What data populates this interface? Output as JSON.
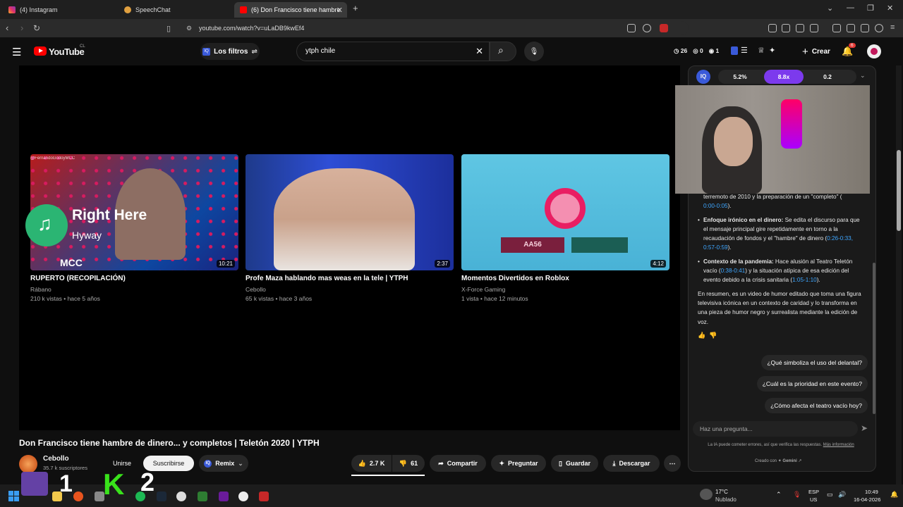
{
  "browser": {
    "tabs": [
      {
        "label": "(4) Instagram",
        "icon": "instagram-icon"
      },
      {
        "label": "SpeechChat",
        "icon": "speechchat-icon"
      },
      {
        "label": "(6) Don Francisco tiene hambre",
        "icon": "youtube-icon",
        "active": true
      }
    ],
    "url": "youtube.com/watch?v=uLaDB9kwEf4",
    "extension_badge": "2"
  },
  "youtube": {
    "logo": "YouTube",
    "logo_region": "CL",
    "filter_label": "Los filtros",
    "search_value": "ytph chile",
    "stats": {
      "a": "26",
      "b": "0",
      "c": "1"
    },
    "create_label": "Crear",
    "notif_count": "6"
  },
  "endscreen": {
    "cards": [
      {
        "title": "RUPERTO (RECOPILACIÓN)",
        "channel": "Rábano",
        "meta": "210 k vistas • hace 5 años",
        "duration": "10:21",
        "watermark": "@FernandoGodoyMCC",
        "thumb_label": "MCC"
      },
      {
        "title": "Profe Maza hablando mas weas en la tele | YTPH",
        "channel": "Cebollo",
        "meta": "65 k vistas • hace 3 años",
        "duration": "2:37"
      },
      {
        "title": "Momentos Divertidos en Roblox",
        "channel": "X-Force Gaming",
        "meta": "1 vista • hace 12 minutos",
        "duration": "4:12",
        "thumb_label": "AA56"
      }
    ]
  },
  "now_playing": {
    "title": "Right Here",
    "artist": "Hyway"
  },
  "video": {
    "title": "Don Francisco tiene hambre de dinero... y completos | Teletón 2020 | YTPH",
    "channel": "Cebollo",
    "subscribers": "35.7 k suscriptores",
    "join": "Unirse",
    "subscribe": "Suscribirse",
    "remix": "Remix",
    "likes": "2.7 K",
    "dislikes": "61",
    "share": "Compartir",
    "ask": "Preguntar",
    "save": "Guardar",
    "download": "Descargar"
  },
  "side": {
    "metrics": [
      "5.2%",
      "8.8x",
      "0.2"
    ],
    "partial_line": "terremoto de 2010 y la preparación de un \"completo\" (",
    "partial_ts": "0:00-0:05",
    "bullets": [
      {
        "title": "Enfoque irónico en el dinero:",
        "text": "Se edita el discurso para que el mensaje principal gire repetidamente en torno a la recaudación de fondos y el \"hambre\" de dinero (",
        "ts": "0:26-0:33, 0:57-0:59",
        "end": ")."
      },
      {
        "title": "Contexto de la pandemia:",
        "text": "Hace alusión al Teatro Teletón vacío (",
        "ts": "0:38-0:41",
        "text2": ") y la situación atípica de esa edición del evento debido a la crisis sanitaria (",
        "ts2": "1:05-1:10",
        "end": ")."
      }
    ],
    "summary": "En resumen, es un video de humor editado que toma una figura televisiva icónica en un contexto de caridad y lo transforma en una pieza de humor negro y surrealista mediante la edición de voz.",
    "suggestions": [
      "¿Qué simboliza el uso del delantal?",
      "¿Cuál es la prioridad en este evento?",
      "¿Cómo afecta el teatro vacío hoy?"
    ],
    "ask_placeholder": "Haz una pregunta...",
    "disclaimer": "La IA puede cometer errores, así que verifica las respuestas.",
    "more_info": "Más información",
    "created_with": "Creado con",
    "gemini": "Gemini"
  },
  "taskbar": {
    "weather_temp": "17°C",
    "weather_desc": "Nublado",
    "lang1": "ESP",
    "lang2": "US",
    "time": "10:49",
    "date": "16-04-2026"
  },
  "overlay": {
    "k_label": "K",
    "num1": "1",
    "num2": "2"
  },
  "colors": {
    "accent": "#ff0000",
    "link": "#3ea6ff",
    "purple": "#7c3aed"
  }
}
